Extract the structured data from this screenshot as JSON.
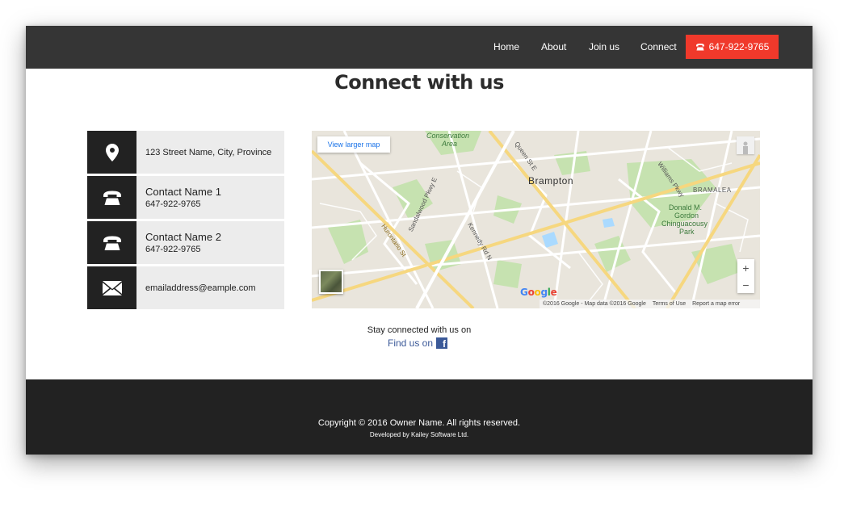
{
  "nav": {
    "items": [
      {
        "label": "Home"
      },
      {
        "label": "About"
      },
      {
        "label": "Join us"
      },
      {
        "label": "Connect"
      }
    ],
    "phone_button": "647-922-9765",
    "phone_button_color": "#f0392b"
  },
  "page": {
    "title": "Connect with us"
  },
  "contacts": {
    "address": "123 Street Name, City, Province",
    "contact1_name": "Contact Name 1",
    "contact1_phone": "647-922-9765",
    "contact2_name": "Contact Name 2",
    "contact2_phone": "647-922-9765",
    "email": "emailaddress@eample.com"
  },
  "map": {
    "view_larger": "View larger map",
    "city": "Brampton",
    "labels": {
      "conservation": "Conservation",
      "area": "Area",
      "bramalea": "BRAMALEA",
      "park1": "Donald M.",
      "park2": "Gordon",
      "park3": "Chinguacousy",
      "park4": "Park",
      "hurontario": "Hurontario St",
      "sandalwood": "Sandalwood Pkwy E",
      "kennedy": "Kennedy Rd N",
      "williams": "Williams Pkwy",
      "queen": "Queen St E"
    },
    "zoom_in": "+",
    "zoom_out": "−",
    "google": "Google",
    "attribution": "©2016 Google - Map data ©2016 Google",
    "terms": "Terms of Use",
    "report": "Report a map error"
  },
  "social": {
    "stay_connected": "Stay connected with us on",
    "find_us": "Find us on",
    "fb_letter": "f"
  },
  "footer": {
    "copyright": "Copyright © 2016 Owner Name. All rights reserved.",
    "developed": "Developed by Kailey Software Ltd."
  }
}
